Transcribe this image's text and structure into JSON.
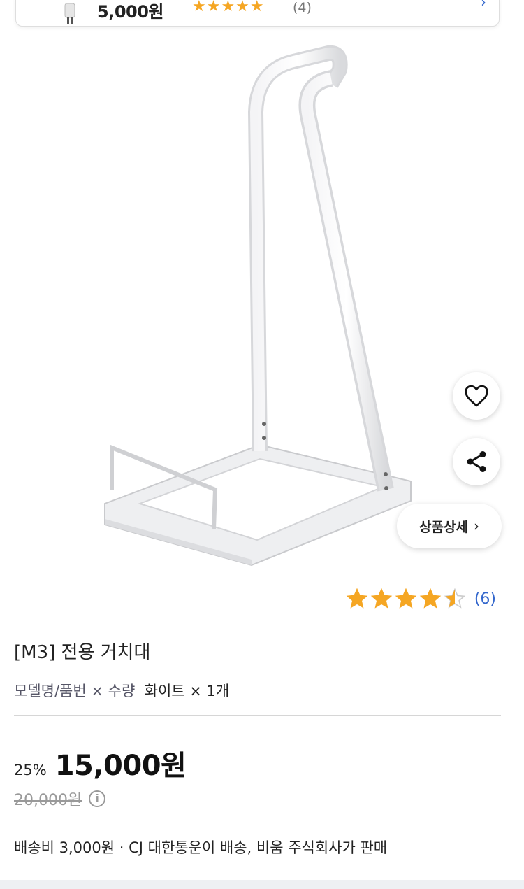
{
  "top_card": {
    "price": "5,000원",
    "stars": "★★★★★",
    "review_count": "(4)",
    "thumb_icon": "plug-icon",
    "chevron_icon": "chevron-right-icon"
  },
  "image": {
    "alt": "vacuum stand product image"
  },
  "actions": {
    "like_icon": "heart-icon",
    "share_icon": "share-icon",
    "detail_label": "상품상세",
    "detail_chevron": "›"
  },
  "rating": {
    "value": 4.5,
    "max": 5,
    "count": "(6)"
  },
  "product": {
    "title": "[M3] 전용 거치대",
    "option_label": "모델명/품번 × 수량",
    "option_value": "화이트 × 1개"
  },
  "price": {
    "discount": "25%",
    "sale": "15,000원",
    "original": "20,000원",
    "info_icon": "i"
  },
  "shipping": {
    "text": "배송비 3,000원 ·  CJ 대한통운이 배송, 비움 주식회사가 판매"
  },
  "colors": {
    "star": "#f5a623",
    "link": "#3266cc",
    "divider": "#d6d6d6"
  }
}
